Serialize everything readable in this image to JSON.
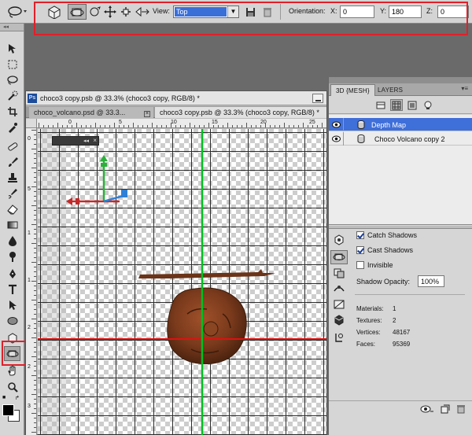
{
  "options_bar": {
    "view_label": "View:",
    "view_value": "Top",
    "orientation_label": "Orientation:",
    "x_label": "X:",
    "x_value": "0",
    "y_label": "Y:",
    "y_value": "180",
    "z_label": "Z:",
    "z_value": "0",
    "icons": [
      "3d-rotate-icon",
      "camera-orbit-icon",
      "camera-roll-icon",
      "camera-pan-icon",
      "camera-walk-icon",
      "camera-zoom-icon",
      "save-view-icon",
      "delete-view-icon"
    ]
  },
  "document": {
    "title": "choco3 copy.psb @ 33.3% (choco3 copy, RGB/8) *",
    "tabs": [
      {
        "label": "choco_volcano.psd @ 33.3...",
        "active": false
      },
      {
        "label": "choco3 copy.psb @ 33.3% (choco3 copy, RGB/8) *",
        "active": true
      }
    ],
    "ruler_top_numbers": [
      "0",
      "5",
      "10",
      "15",
      "20",
      "25"
    ],
    "ruler_left_numbers": [
      "0",
      "5",
      "1",
      "1",
      "2",
      "2",
      "3"
    ]
  },
  "panel": {
    "tabs": [
      "3D {MESH}",
      "LAYERS"
    ],
    "scene_items": [
      {
        "label": "Depth Map",
        "selected": true
      },
      {
        "label": "Choco Volcano copy 2",
        "selected": false
      }
    ],
    "catch_shadows_label": "Catch Shadows",
    "catch_shadows_checked": true,
    "cast_shadows_label": "Cast Shadows",
    "cast_shadows_checked": true,
    "invisible_label": "Invisible",
    "invisible_checked": false,
    "shadow_opacity_label": "Shadow Opacity:",
    "shadow_opacity_value": "100%",
    "stats": [
      {
        "label": "Materials:",
        "value": "1"
      },
      {
        "label": "Textures:",
        "value": "2"
      },
      {
        "label": "Vertices:",
        "value": "48167"
      },
      {
        "label": "Faces:",
        "value": "95369"
      }
    ]
  },
  "colors": {
    "highlight": "#e0202a",
    "selection": "#3f6fd9",
    "guide_green": "#00c020",
    "guide_red": "#e01010",
    "chocolate": "#7a3a1c"
  }
}
